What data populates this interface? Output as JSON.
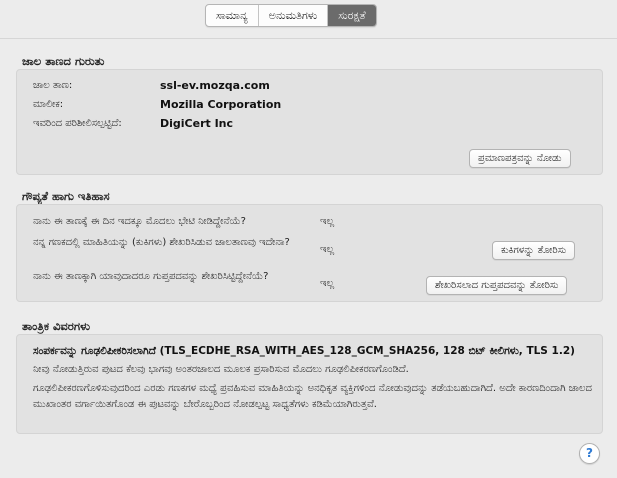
{
  "tabs": [
    "ಸಾಮಾನ್ಯ",
    "ಅನುಮತಿಗಳು",
    "ಸುರಕ್ಷತೆ"
  ],
  "identity": {
    "title": "ಜಾಲ ತಾಣದ ಗುರುತು",
    "rows": [
      {
        "label": "ಜಾಲ ತಾಣ:",
        "value": "ssl-ev.mozqa.com"
      },
      {
        "label": "ಮಾಲೀಕ:",
        "value": "Mozilla Corporation"
      },
      {
        "label": "ಇವರಿಂದ ಪರಿಶೀಲಿಸಲ್ಪಟ್ಟಿದೆ:",
        "value": "DigiCert Inc"
      }
    ],
    "view_cert_button": "ಪ್ರಮಾಣಪತ್ರವನ್ನು ನೋಡು"
  },
  "privacy": {
    "title": "ಗೌಪ್ಯತೆ ಹಾಗು ಇತಿಹಾಸ",
    "rows": [
      {
        "question": "ನಾನು ಈ ತಾಣಕ್ಕೆ ಈ ದಿನ ಇದಕ್ಕೂ ಮೊದಲು ಭೇಟಿ ನೀಡಿದ್ದೇನೆಯೆ?",
        "answer": "ಇಲ್ಲ"
      },
      {
        "question": "ನನ್ನ ಗಣಕದಲ್ಲಿ ಮಾಹಿತಿಯನ್ನು (ಕುಕಿಗಳು) ಶೇಖರಿಸಿಡುವ ಜಾಲತಾಣವು ಇದೇನಾ?",
        "answer": "ಇಲ್ಲ",
        "button": "ಕುಕಿಗಳನ್ನು ತೋರಿಸು"
      },
      {
        "question": "ನಾನು ಈ ತಾಣಕ್ಕಾಗಿ ಯಾವುದಾದರೂ ಗುಪ್ತಪದವನ್ನು ಶೇಖರಿಸಿಟ್ಟಿದ್ದೇನೆಯೆ?",
        "answer": "ಇಲ್ಲ",
        "button": "ಶೇಖರಿಸಲಾದ ಗುಪ್ತಪದವನ್ನು ತೋರಿಸು"
      }
    ]
  },
  "technical": {
    "title": "ತಾಂತ್ರಿಕ ವಿವರಗಳು",
    "connection": "ಸಂಪರ್ಕವನ್ನು ಗೂಢಲಿಪೀಕರಿಸಲಾಗಿದೆ (TLS_ECDHE_RSA_WITH_AES_128_GCM_SHA256, 128 ಬಿಟ್ ಕೀಲಿಗಳು, TLS 1.2)",
    "para1": "ನೀವು ನೋಡುತ್ತಿರುವ ಪುಟದ ಕೆಲವು ಭಾಗವು ಅಂತರಜಾಲದ ಮೂಲಕ ಪ್ರಸಾರಿಸುವ ಮೊದಲು ಗೂಢಲಿಪೀಕರಣಗೊಂಡಿದೆ.",
    "para2": "ಗೂಢಲಿಪೀಕರಣಗೊಳಿಸುವುದರಿಂದ ಎರಡು ಗಣಕಗಳ ಮಧ್ಯೆ ಪ್ರವಹಿಸುವ ಮಾಹಿತಿಯನ್ನು ಅನಧಿಕೃತ ವ್ಯಕ್ತಿಗಳಿಂದ ನೋಡುವುದನ್ನು ತಡೆಯಬಹುದಾಗಿದೆ. ಅದೇ ಕಾರಣದಿಂದಾಗಿ ಜಾಲದ ಮುಖಾಂತರ ವರ್ಗಾಯಿತಗೊಂಡ ಈ ಪುಟವನ್ನು ಬೇರೊಬ್ಬರಿಂದ ನೋಡಲ್ಪಟ್ಟ ಸಾಧ್ಯತೆಗಳು ಕಡಿಮೆಯಾಗಿರುತ್ತವೆ."
  },
  "help_label": "?"
}
